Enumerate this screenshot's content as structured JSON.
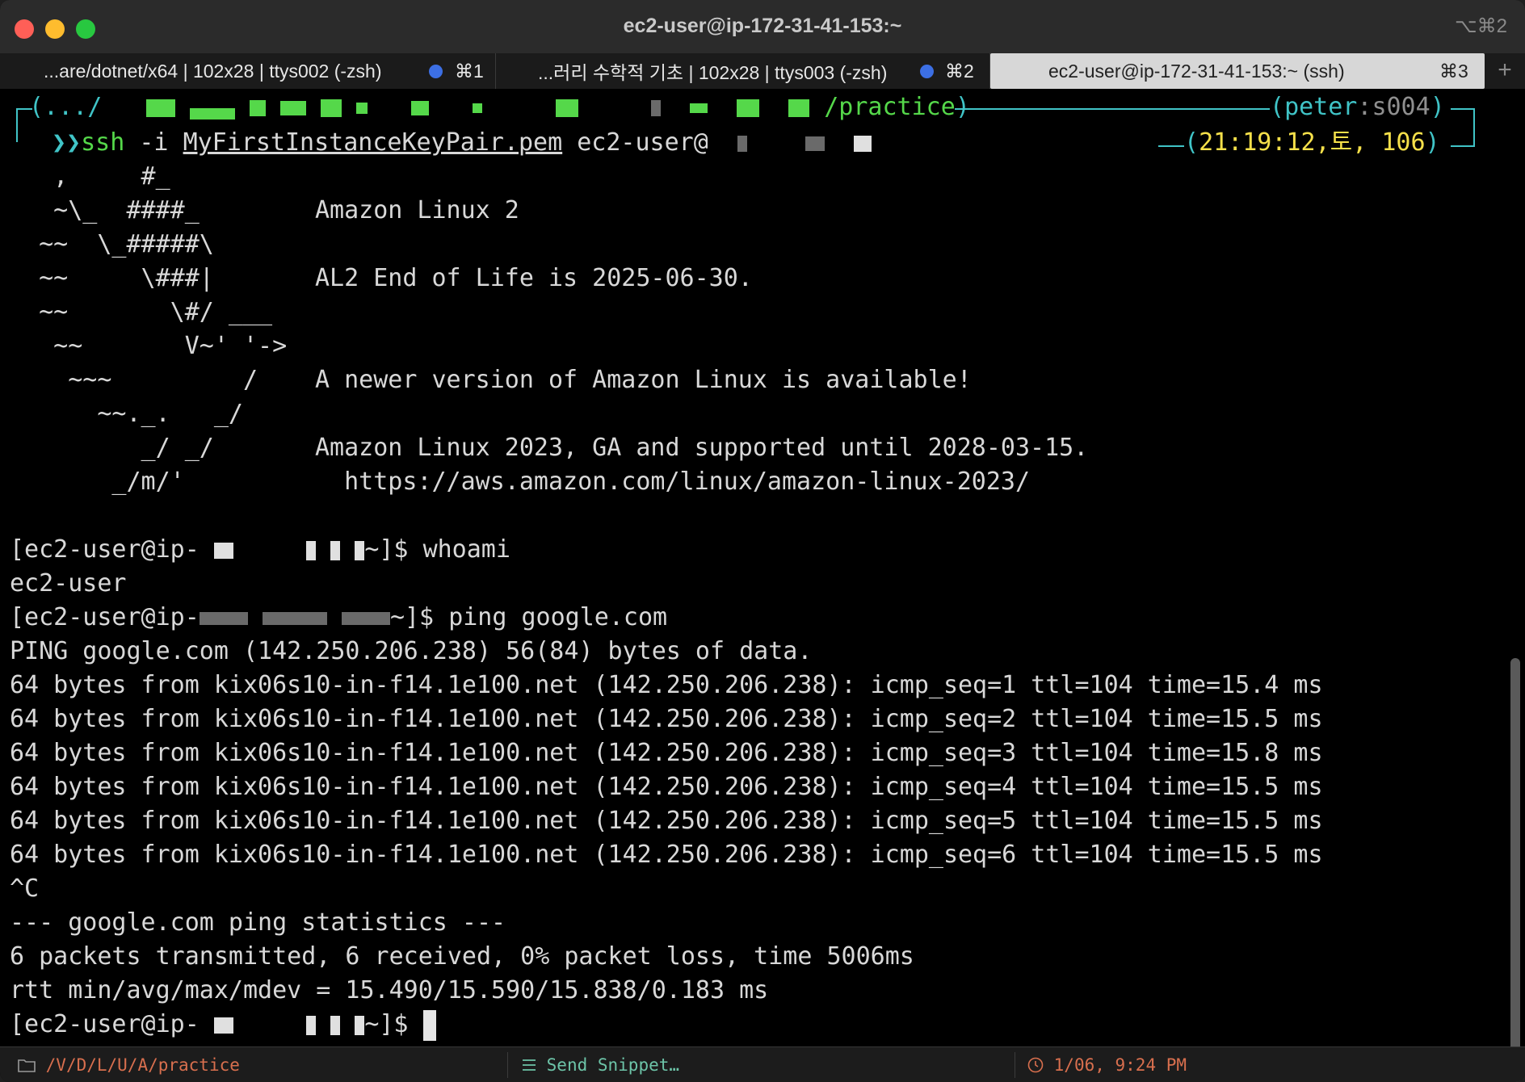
{
  "window": {
    "title": "ec2-user@ip-172-31-41-153:~",
    "shortcut": "⌥⌘2",
    "colors": {
      "close": "#ff5f57",
      "minimize": "#febc2e",
      "zoom": "#28c840",
      "tab_dot": "#3c6fe4"
    }
  },
  "tabs": [
    {
      "label": "...are/dotnet/x64 | 102x28 | ttys002 (-zsh)",
      "shortcut": "⌘1"
    },
    {
      "label": "...러리 수학적 기초 | 102x28 | ttys003 (-zsh)",
      "shortcut": "⌘2"
    },
    {
      "label": "ec2-user@ip-172-31-41-153:~ (ssh)",
      "shortcut": "⌘3"
    }
  ],
  "tab_add": "+",
  "prompt_header": {
    "path_start": "(.../",
    "path_end": "/practice",
    "user": "peter",
    "host": "s004",
    "arrow": "❯❯",
    "command": "ssh",
    "command_args_1": " -i ",
    "keyfile": "MyFirstInstanceKeyPair.pem",
    "command_args_2": " ec2-user@",
    "time": "21:19:12,토, 106"
  },
  "motd": [
    {
      "art": "   ,     #_",
      "text": ""
    },
    {
      "art": "   ~\\_  ####_",
      "text": "Amazon Linux 2"
    },
    {
      "art": "  ~~  \\_#####\\",
      "text": ""
    },
    {
      "art": "  ~~     \\###|",
      "text": "AL2 End of Life is 2025-06-30."
    },
    {
      "art": "  ~~       \\#/ ___",
      "text": ""
    },
    {
      "art": "   ~~       V~' '->",
      "text": ""
    },
    {
      "art": "    ~~~         /",
      "text": "A newer version of Amazon Linux is available!"
    },
    {
      "art": "      ~~._.   _/",
      "text": ""
    },
    {
      "art": "         _/ _/",
      "text": "Amazon Linux 2023, GA and supported until 2028-03-15."
    },
    {
      "art": "       _/m/'",
      "text": "  https://aws.amazon.com/linux/amazon-linux-2023/"
    }
  ],
  "session": {
    "prompt_prefix": "[ec2-user@ip-",
    "prompt_suffix": "~]$ ",
    "cmd_whoami": "whoami",
    "out_whoami": "ec2-user",
    "cmd_ping": "ping google.com",
    "ping_header": "PING google.com (142.250.206.238) 56(84) bytes of data.",
    "ping_replies": [
      "64 bytes from kix06s10-in-f14.1e100.net (142.250.206.238): icmp_seq=1 ttl=104 time=15.4 ms",
      "64 bytes from kix06s10-in-f14.1e100.net (142.250.206.238): icmp_seq=2 ttl=104 time=15.5 ms",
      "64 bytes from kix06s10-in-f14.1e100.net (142.250.206.238): icmp_seq=3 ttl=104 time=15.8 ms",
      "64 bytes from kix06s10-in-f14.1e100.net (142.250.206.238): icmp_seq=4 ttl=104 time=15.5 ms",
      "64 bytes from kix06s10-in-f14.1e100.net (142.250.206.238): icmp_seq=5 ttl=104 time=15.5 ms",
      "64 bytes from kix06s10-in-f14.1e100.net (142.250.206.238): icmp_seq=6 ttl=104 time=15.5 ms"
    ],
    "interrupt": "^C",
    "stats_header": "--- google.com ping statistics ---",
    "stats_packets": "6 packets transmitted, 6 received, 0% packet loss, time 5006ms",
    "stats_rtt": "rtt min/avg/max/mdev = 15.490/15.590/15.838/0.183 ms"
  },
  "statusbar": {
    "folder_icon": "folder-icon",
    "path": "/V/D/L/U/A/practice",
    "snippet_icon": "snippet-icon",
    "snippet": "Send Snippet…",
    "clock_icon": "clock-icon",
    "datetime": "1/06, 9:24 PM"
  }
}
